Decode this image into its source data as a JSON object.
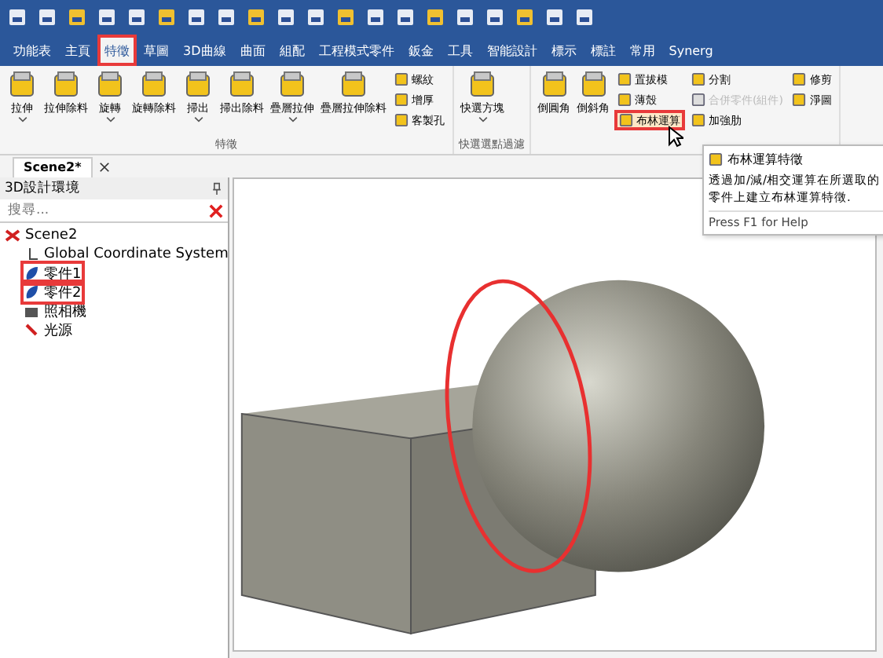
{
  "tabs": [
    {
      "label": "功能表",
      "selected": false
    },
    {
      "label": "主頁",
      "selected": false
    },
    {
      "label": "特徵",
      "selected": true
    },
    {
      "label": "草圖",
      "selected": false
    },
    {
      "label": "3D曲線",
      "selected": false
    },
    {
      "label": "曲面",
      "selected": false
    },
    {
      "label": "組配",
      "selected": false
    },
    {
      "label": "工程模式零件",
      "selected": false
    },
    {
      "label": "鈑金",
      "selected": false
    },
    {
      "label": "工具",
      "selected": false
    },
    {
      "label": "智能設計",
      "selected": false
    },
    {
      "label": "標示",
      "selected": false
    },
    {
      "label": "標註",
      "selected": false
    },
    {
      "label": "常用",
      "selected": false
    },
    {
      "label": "Synerg",
      "selected": false
    }
  ],
  "ribbon_groups": [
    {
      "label": "特徵",
      "large": [
        {
          "label": "拉伸",
          "dropdown": true
        },
        {
          "label": "拉伸除料",
          "dropdown": false
        },
        {
          "label": "旋轉",
          "dropdown": true
        },
        {
          "label": "旋轉除料",
          "dropdown": false
        },
        {
          "label": "掃出",
          "dropdown": true
        },
        {
          "label": "掃出除料",
          "dropdown": false
        },
        {
          "label": "疊層拉伸",
          "dropdown": true
        },
        {
          "label": "疊層拉伸除料",
          "dropdown": false
        }
      ],
      "small": [
        {
          "label": "螺紋",
          "disabled": false,
          "selected": false
        },
        {
          "label": "增厚",
          "disabled": false,
          "selected": false
        },
        {
          "label": "客製孔",
          "disabled": false,
          "selected": false
        }
      ]
    },
    {
      "label": "快選選點過濾",
      "large": [
        {
          "label": "快選方塊",
          "dropdown": true
        }
      ]
    },
    {
      "large": [
        {
          "label": "倒圓角",
          "dropdown": false
        },
        {
          "label": "倒斜角",
          "dropdown": false
        }
      ],
      "small": [
        {
          "label": "置拔模",
          "disabled": false,
          "selected": false
        },
        {
          "label": "薄殼",
          "disabled": false,
          "selected": false
        },
        {
          "label": "布林運算",
          "disabled": false,
          "selected": true
        },
        {
          "label": "分割",
          "disabled": false,
          "selected": false
        },
        {
          "label": "合併零件(組件)",
          "disabled": true,
          "selected": false
        },
        {
          "label": "加強肋",
          "disabled": false,
          "selected": false
        },
        {
          "label": "修剪",
          "disabled": false,
          "selected": false
        },
        {
          "label": "淨圖",
          "disabled": false,
          "selected": false
        }
      ]
    }
  ],
  "tooltip": {
    "title": "布林運算特徵",
    "description": "透過加/減/相交運算在所選取的零件上建立布林運算特徵.",
    "help": "Press F1 for Help"
  },
  "document_tab": {
    "label": "Scene2*"
  },
  "panel": {
    "title": "3D設計環境",
    "search": {
      "placeholder": "搜尋..."
    },
    "tree": [
      {
        "label": "Scene2",
        "kind": "scene",
        "children": [
          {
            "label": "Global Coordinate System",
            "kind": "axes",
            "highlighted": false
          },
          {
            "label": "零件1",
            "kind": "part",
            "highlighted": true
          },
          {
            "label": "零件2",
            "kind": "part",
            "highlighted": true
          },
          {
            "label": "照相機",
            "kind": "camera",
            "highlighted": false
          },
          {
            "label": "光源",
            "kind": "light",
            "highlighted": false
          }
        ]
      }
    ]
  }
}
